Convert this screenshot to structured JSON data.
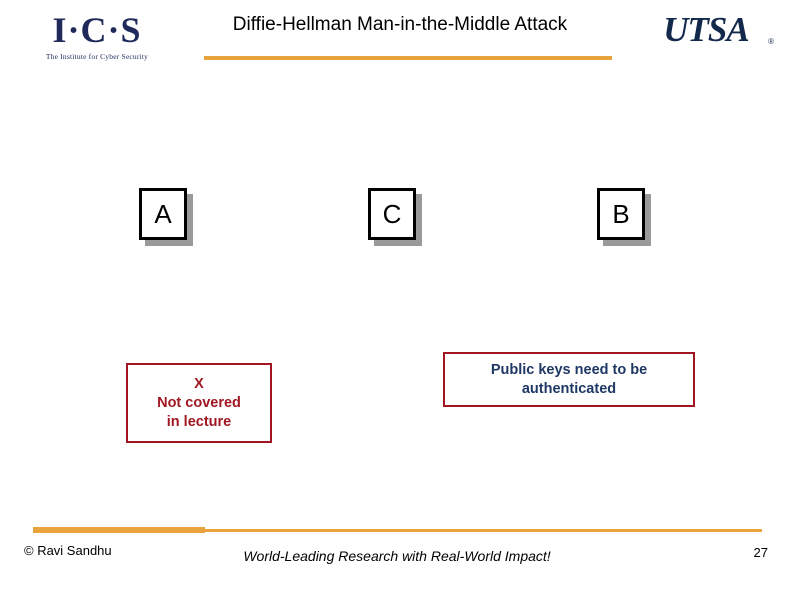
{
  "header": {
    "title": "Diffie-Hellman Man-in-the-Middle Attack",
    "ics_logo_main": "I·C·S",
    "ics_logo_sub": "The Institute for Cyber Security",
    "utsa_logo_text": "UTSA",
    "utsa_registered": "®",
    "rule_color": "#E8A33D"
  },
  "parties": [
    {
      "label": "A",
      "name": "party-a"
    },
    {
      "label": "C",
      "name": "party-c"
    },
    {
      "label": "B",
      "name": "party-b"
    }
  ],
  "callouts": {
    "left": {
      "line1": "X",
      "line2": "Not covered",
      "line3": "in lecture",
      "color": "#A01722"
    },
    "right": {
      "line1": "Public keys need to be",
      "line2": "authenticated",
      "color": "#1F3864",
      "border_color": "#A01722"
    }
  },
  "footer": {
    "copyright": "© Ravi  Sandhu",
    "tagline": "World-Leading Research with Real-World Impact!",
    "page_number": "27"
  }
}
